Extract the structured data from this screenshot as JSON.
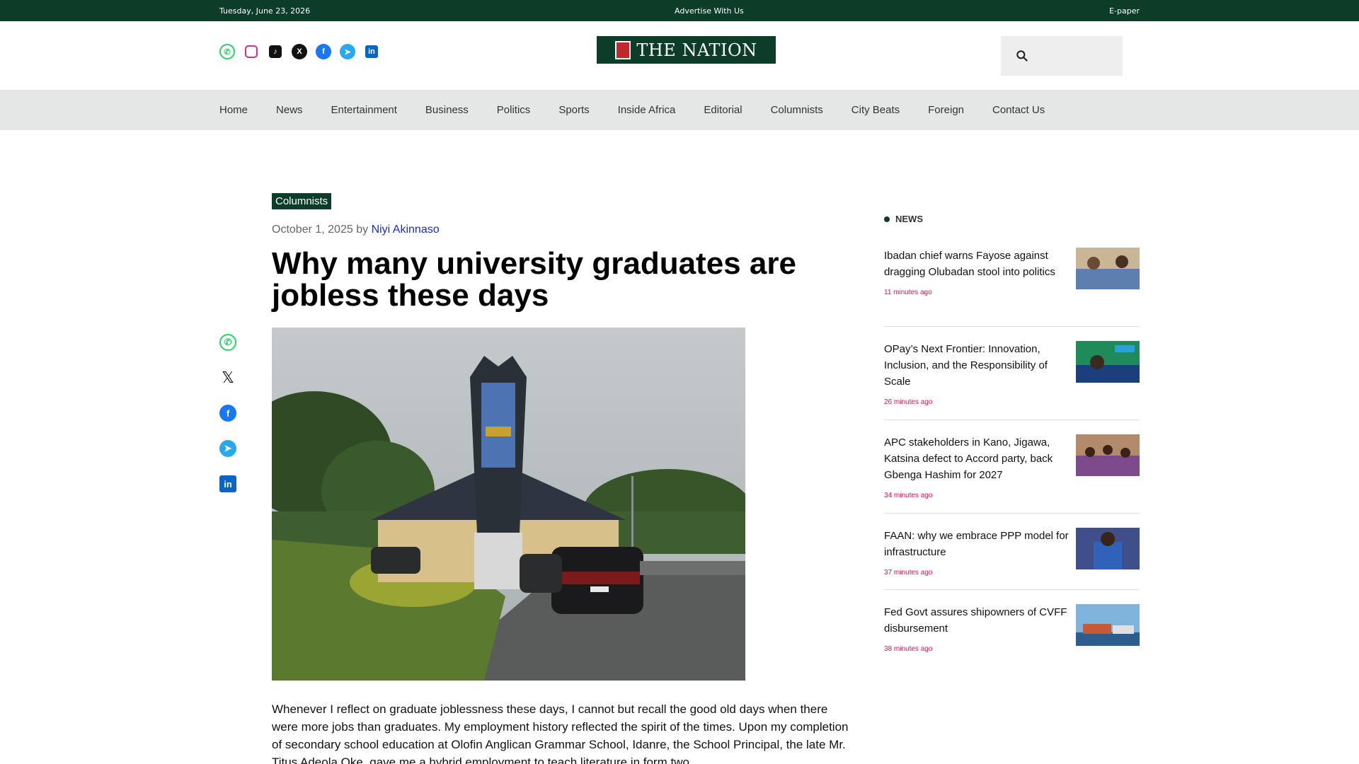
{
  "topbar": {
    "date": "Tuesday, June 23, 2026",
    "advertise": "Advertise With Us",
    "epaper": "E-paper"
  },
  "header": {
    "logo_text": "THE NATION",
    "socials": [
      "whatsapp-icon",
      "instagram-icon",
      "tiktok-icon",
      "x-icon",
      "facebook-icon",
      "telegram-icon",
      "linkedin-icon"
    ],
    "search_placeholder": ""
  },
  "nav": {
    "items": [
      "Home",
      "News",
      "Entertainment",
      "Business",
      "Politics",
      "Sports",
      "Inside Africa",
      "Editorial",
      "Columnists",
      "City Beats",
      "Foreign",
      "Contact Us"
    ]
  },
  "article": {
    "category": "Columnists",
    "date": "October 1, 2025",
    "by": "by",
    "author": "Niyi Akinnaso",
    "headline": "Why many university graduates are jobless these days",
    "body": "Whenever I reflect on graduate joblessness these days, I cannot but recall the good old days when there were more jobs than graduates. My employment history reflected the spirit of the times. Upon my completion of secondary school education at Olofin Anglican Grammar School, Idanre, the School Principal, the late Mr. Titus Adeola Oke, gave me a hybrid employment to teach literature in form two"
  },
  "share": [
    "whatsapp-icon",
    "x-icon",
    "facebook-icon",
    "telegram-icon",
    "linkedin-icon"
  ],
  "sidebar": {
    "heading": "NEWS",
    "items": [
      {
        "title": "Ibadan chief warns Fayose against dragging Olubadan stool into politics",
        "time": "11 minutes ago"
      },
      {
        "title": "OPay’s Next Frontier: Innovation, Inclusion, and the Responsibility of Scale",
        "time": "26 minutes ago"
      },
      {
        "title": "APC stakeholders in Kano, Jigawa, Katsina defect to Accord party, back Gbenga Hashim for 2027",
        "time": "34 minutes ago"
      },
      {
        "title": "FAAN: why we embrace PPP model for infrastructure",
        "time": "37 minutes ago"
      },
      {
        "title": "Fed Govt assures shipowners of CVFF disbursement",
        "time": "38 minutes ago"
      }
    ]
  },
  "colors": {
    "brand_green": "#0b3d28",
    "time_pink": "#d4145a",
    "author_blue": "#1a2fc2"
  }
}
